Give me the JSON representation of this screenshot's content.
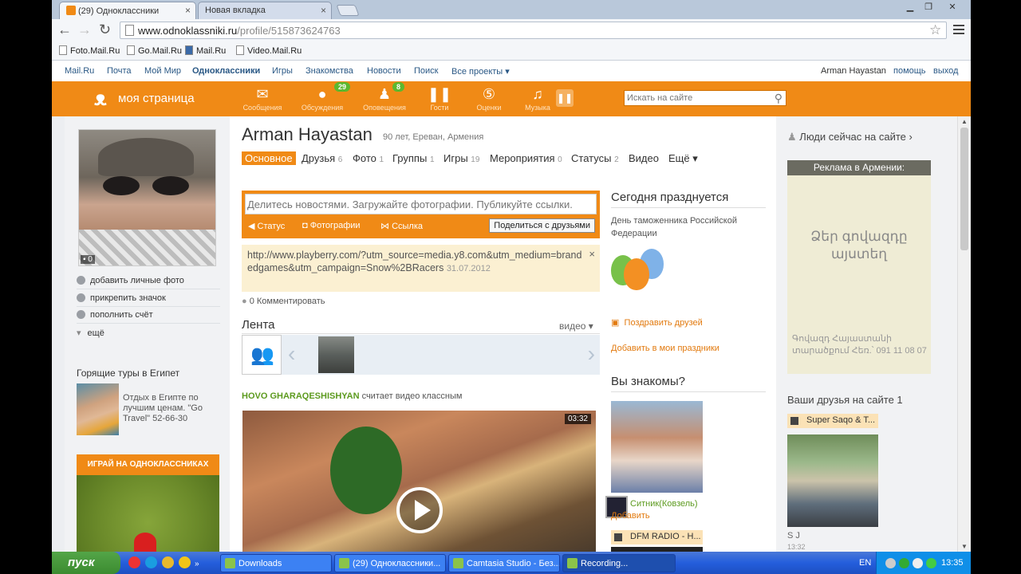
{
  "browser": {
    "tabs": [
      {
        "title": "(29) Одноклассники",
        "active": true
      },
      {
        "title": "Новая вкладка",
        "active": false
      }
    ],
    "url_host": "www.odnoklassniki.ru",
    "url_path": "/profile/515873624763",
    "bookmarks": [
      "Foto.Mail.Ru",
      "Go.Mail.Ru",
      "Mail.Ru",
      "Video.Mail.Ru"
    ]
  },
  "sitenav": {
    "links": [
      "Mail.Ru",
      "Почта",
      "Мой Мир",
      "Одноклассники",
      "Игры",
      "Знакомства",
      "Новости",
      "Поиск",
      "Все проекты ▾"
    ],
    "user": "Arman Hayastan",
    "help": "помощь",
    "logout": "выход"
  },
  "topbar": {
    "my_page": "моя страница",
    "items": [
      {
        "label": "Сообщения",
        "icon": "envelope-icon",
        "glyph": "✉",
        "badge": ""
      },
      {
        "label": "Обсуждения",
        "icon": "chat-icon",
        "glyph": "💬",
        "badge": "29"
      },
      {
        "label": "Оповещения",
        "icon": "bell-icon",
        "glyph": "🔔",
        "badge": "8"
      },
      {
        "label": "Гости",
        "icon": "footprints-icon",
        "glyph": "👣",
        "badge": ""
      },
      {
        "label": "Оценки",
        "icon": "rating-icon",
        "glyph": "5",
        "badge": ""
      },
      {
        "label": "Музыка",
        "icon": "music-icon",
        "glyph": "♫",
        "badge": ""
      }
    ],
    "search_placeholder": "Искать на сайте"
  },
  "left": {
    "photo_count": "0",
    "actions": [
      "добавить личные фото",
      "прикрепить значок",
      "пополнить счёт",
      "ещё"
    ],
    "ad_title": "Горящие туры в Египет",
    "ad_text": "Отдых в Египте по лучшим ценам. \"Go Travel\" 52-66-30",
    "game_banner": "ИГРАЙ НА ОДНОКЛАССНИКАХ"
  },
  "profile": {
    "name": "Arman Hayastan",
    "sub": "90 лет, Ереван, Армения",
    "tabs": [
      {
        "label": "Основное",
        "count": ""
      },
      {
        "label": "Друзья",
        "count": "6"
      },
      {
        "label": "Фото",
        "count": "1"
      },
      {
        "label": "Группы",
        "count": "1"
      },
      {
        "label": "Игры",
        "count": "19"
      },
      {
        "label": "Мероприятия",
        "count": "0"
      },
      {
        "label": "Статусы",
        "count": "2"
      },
      {
        "label": "Видео",
        "count": ""
      },
      {
        "label": "Ещё ▾",
        "count": ""
      }
    ]
  },
  "share": {
    "placeholder": "Делитесь новостями. Загружайте фотографии. Публикуйте ссылки.",
    "status": "Статус",
    "photos": "Фотографии",
    "link": "Ссылка",
    "button": "Поделиться с друзьями"
  },
  "linkpost": {
    "url": "http://www.playberry.com/?utm_source=media.y8.com&utm_medium=brandedgames&utm_campaign=Snow%2BRacers",
    "date": "31.07.2012",
    "comments": "0 Комментировать"
  },
  "feed": {
    "title": "Лента",
    "filter": "видео ▾",
    "post_user": "HOVO GHARAQESHISHYAN",
    "post_action": "считает видео классным",
    "video_duration": "03:32"
  },
  "today": {
    "title": "Сегодня празднуется",
    "holiday": "День таможенника Российской Федерации",
    "congratulate": "Поздравить друзей",
    "add": "Добавить в мои праздники"
  },
  "know": {
    "title": "Вы знакомы?",
    "name": "Ситник(Ковзель)",
    "add": "Добавить",
    "dfm": "DFM RADIO - H..."
  },
  "right": {
    "people_now": "Люди сейчас на сайте ›",
    "ad_header": "Реклама в Армении:",
    "ad_big": "Ձեր գովազդը այստեղ",
    "ad_small": "Գովազդ Հայաստանի տարածքում Հեռ.՝ 091 11 08 07",
    "friends_on_site": "Ваши друзья на сайте 1",
    "friend_music": "Super Saqo & T...",
    "friend_name": "S J",
    "friend_time": "13:32"
  },
  "taskbar": {
    "start": "пуск",
    "tasks": [
      "Downloads",
      "(29) Одноклассники...",
      "Camtasia Studio - Без...",
      "Recording..."
    ],
    "lang": "EN",
    "clock": "13:35"
  },
  "colors": {
    "accent": "#f08a16",
    "link": "#2a5885",
    "green": "#5c9a1e"
  }
}
